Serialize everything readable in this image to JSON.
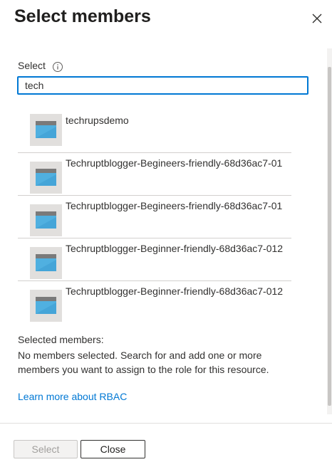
{
  "panel": {
    "title": "Select members"
  },
  "search": {
    "label": "Select",
    "value": "tech"
  },
  "results": [
    {
      "name": "techrupsdemo"
    },
    {
      "name": "Techruptblogger-Begineers-friendly-68d36ac7-01"
    },
    {
      "name": "Techruptblogger-Begineers-friendly-68d36ac7-01"
    },
    {
      "name": "Techruptblogger-Beginner-friendly-68d36ac7-012"
    },
    {
      "name": "Techruptblogger-Beginner-friendly-68d36ac7-012"
    }
  ],
  "selected": {
    "heading": "Selected members:",
    "empty_text": "No members selected. Search for and add one or more members you want to assign to the role for this resource."
  },
  "links": {
    "learn_more": "Learn more about RBAC"
  },
  "footer": {
    "select_label": "Select",
    "close_label": "Close"
  },
  "colors": {
    "accent": "#0078d4",
    "app_icon": "#50b0e0"
  },
  "icons": {
    "close": "close-icon",
    "info": "info-icon",
    "row": "app-registration-icon",
    "scroll_up": "triangle-up-icon",
    "scroll_down": "triangle-down-icon"
  }
}
